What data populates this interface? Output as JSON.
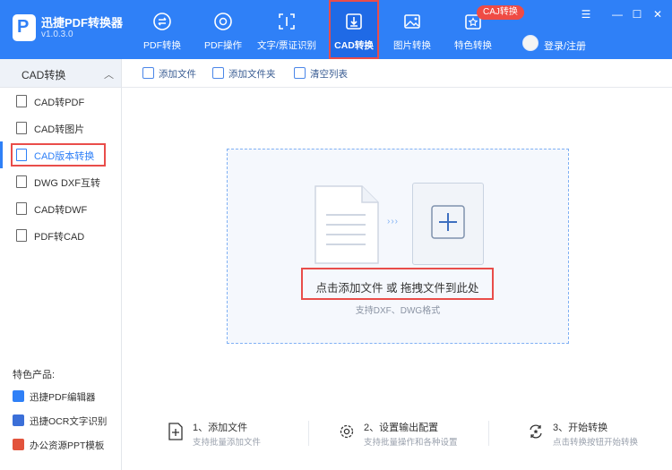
{
  "app": {
    "title": "迅捷PDF转换器",
    "version": "v1.0.3.0",
    "brand_color": "#2f80f7",
    "highlight_color": "#e94d4a"
  },
  "nav": {
    "items": [
      {
        "label": "PDF转换",
        "icon": "pdf-convert-icon"
      },
      {
        "label": "PDF操作",
        "icon": "pdf-operate-icon"
      },
      {
        "label": "文字/票证识别",
        "icon": "text-recognize-icon"
      },
      {
        "label": "CAD转换",
        "icon": "cad-convert-icon",
        "active": true
      },
      {
        "label": "图片转换",
        "icon": "image-convert-icon"
      },
      {
        "label": "特色转换",
        "icon": "special-convert-icon"
      }
    ],
    "badge": "CAJ转换",
    "login_label": "登录/注册"
  },
  "window": {
    "menu": "☰",
    "minimize": "—",
    "maximize": "☐",
    "close": "✕"
  },
  "sidebar": {
    "header": "CAD转换",
    "items": [
      {
        "label": "CAD转PDF",
        "icon": "pdf-file-icon"
      },
      {
        "label": "CAD转图片",
        "icon": "image-file-icon"
      },
      {
        "label": "CAD版本转换",
        "icon": "version-icon",
        "selected": true
      },
      {
        "label": "DWG DXF互转",
        "icon": "dwg-file-icon"
      },
      {
        "label": "CAD转DWF",
        "icon": "dwf-file-icon"
      },
      {
        "label": "PDF转CAD",
        "icon": "cad-file-icon"
      }
    ],
    "featured_title": "特色产品:",
    "featured": [
      {
        "label": "迅捷PDF编辑器",
        "icon": "pdf-editor-icon"
      },
      {
        "label": "迅捷OCR文字识别",
        "icon": "ocr-icon"
      },
      {
        "label": "办公资源PPT模板",
        "icon": "ppt-template-icon"
      }
    ]
  },
  "toolbar": {
    "add_file": "添加文件",
    "add_folder": "添加文件夹",
    "clear_list": "清空列表"
  },
  "dropzone": {
    "main": "点击添加文件 或 拖拽文件到此处",
    "sub": "支持DXF、DWG格式"
  },
  "steps": [
    {
      "title": "1、添加文件",
      "desc": "支持批量添加文件",
      "icon": "add-file-step-icon"
    },
    {
      "title": "2、设置输出配置",
      "desc": "支持批量操作和各种设置",
      "icon": "settings-gear-icon"
    },
    {
      "title": "3、开始转换",
      "desc": "点击转换按钮开始转换",
      "icon": "convert-refresh-icon"
    }
  ]
}
